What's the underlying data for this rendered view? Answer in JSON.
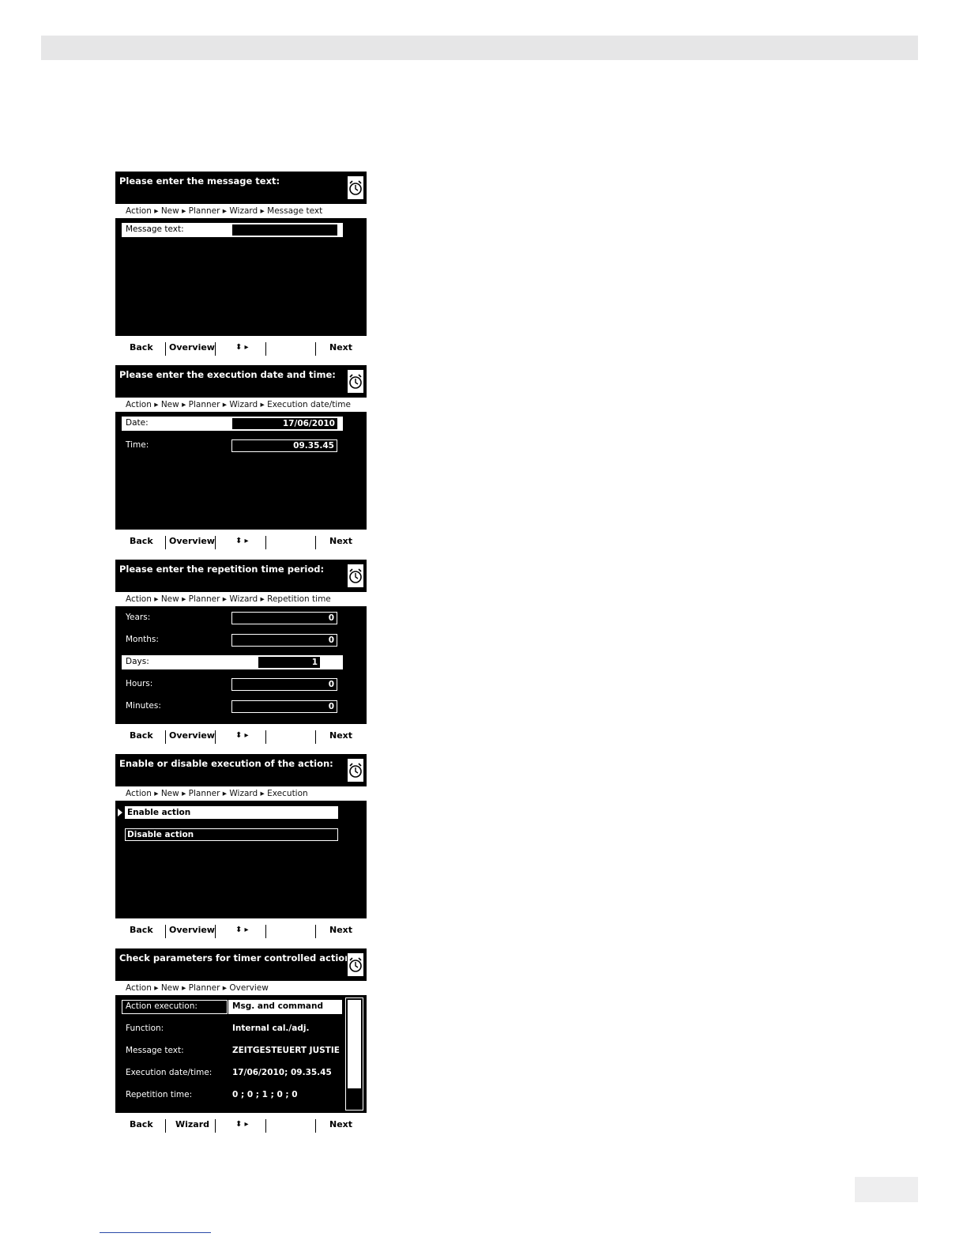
{
  "screens": [
    {
      "title": "Please enter the message text:",
      "breadcrumb": "Action ▸ New ▸ Planner ▸ Wizard ▸ Message text",
      "fields": [
        {
          "label": "Message text:",
          "value": ""
        }
      ],
      "softkeys": {
        "back": "Back",
        "mid": "Overview",
        "next": "Next"
      }
    },
    {
      "title": "Please enter the execution date and time:",
      "breadcrumb": "Action ▸ New ▸ Planner ▸ Wizard ▸ Execution date/time",
      "fields": [
        {
          "label": "Date:",
          "value": "17/06/2010"
        },
        {
          "label": "Time:",
          "value": "09.35.45"
        }
      ],
      "softkeys": {
        "back": "Back",
        "mid": "Overview",
        "next": "Next"
      }
    },
    {
      "title": "Please enter the repetition time period:",
      "breadcrumb": "Action ▸ New ▸ Planner ▸ Wizard ▸ Repetition time",
      "fields": [
        {
          "label": "Years:",
          "value": "0"
        },
        {
          "label": "Months:",
          "value": "0"
        },
        {
          "label": "Days:",
          "value": "1"
        },
        {
          "label": "Hours:",
          "value": "0"
        },
        {
          "label": "Minutes:",
          "value": "0"
        }
      ],
      "softkeys": {
        "back": "Back",
        "mid": "Overview",
        "next": "Next"
      }
    },
    {
      "title": "Enable or disable execution of the action:",
      "breadcrumb": "Action ▸ New ▸ Planner ▸ Wizard ▸ Execution",
      "options": [
        "Enable action",
        "Disable action"
      ],
      "softkeys": {
        "back": "Back",
        "mid": "Overview",
        "next": "Next"
      }
    },
    {
      "title": "Check parameters for timer controlled actions:",
      "breadcrumb": "Action ▸ New ▸ Planner ▸ Overview",
      "fields": [
        {
          "label": "Action execution:",
          "value": "Msg. and command"
        },
        {
          "label": "Function:",
          "value": "Internal cal./adj."
        },
        {
          "label": "Message text:",
          "value": "ZEITGESTEUERT JUSTIERI"
        },
        {
          "label": "Execution date/time:",
          "value": "17/06/2010; 09.35.45"
        },
        {
          "label": "Repetition time:",
          "value": "0 ; 0 ; 1 ; 0 ; 0"
        }
      ],
      "softkeys": {
        "back": "Back",
        "mid": "Wizard",
        "next": "Next"
      }
    }
  ],
  "icons": {
    "timer": "timer-clock-icon",
    "nav": "up-down-right-arrows-icon"
  }
}
